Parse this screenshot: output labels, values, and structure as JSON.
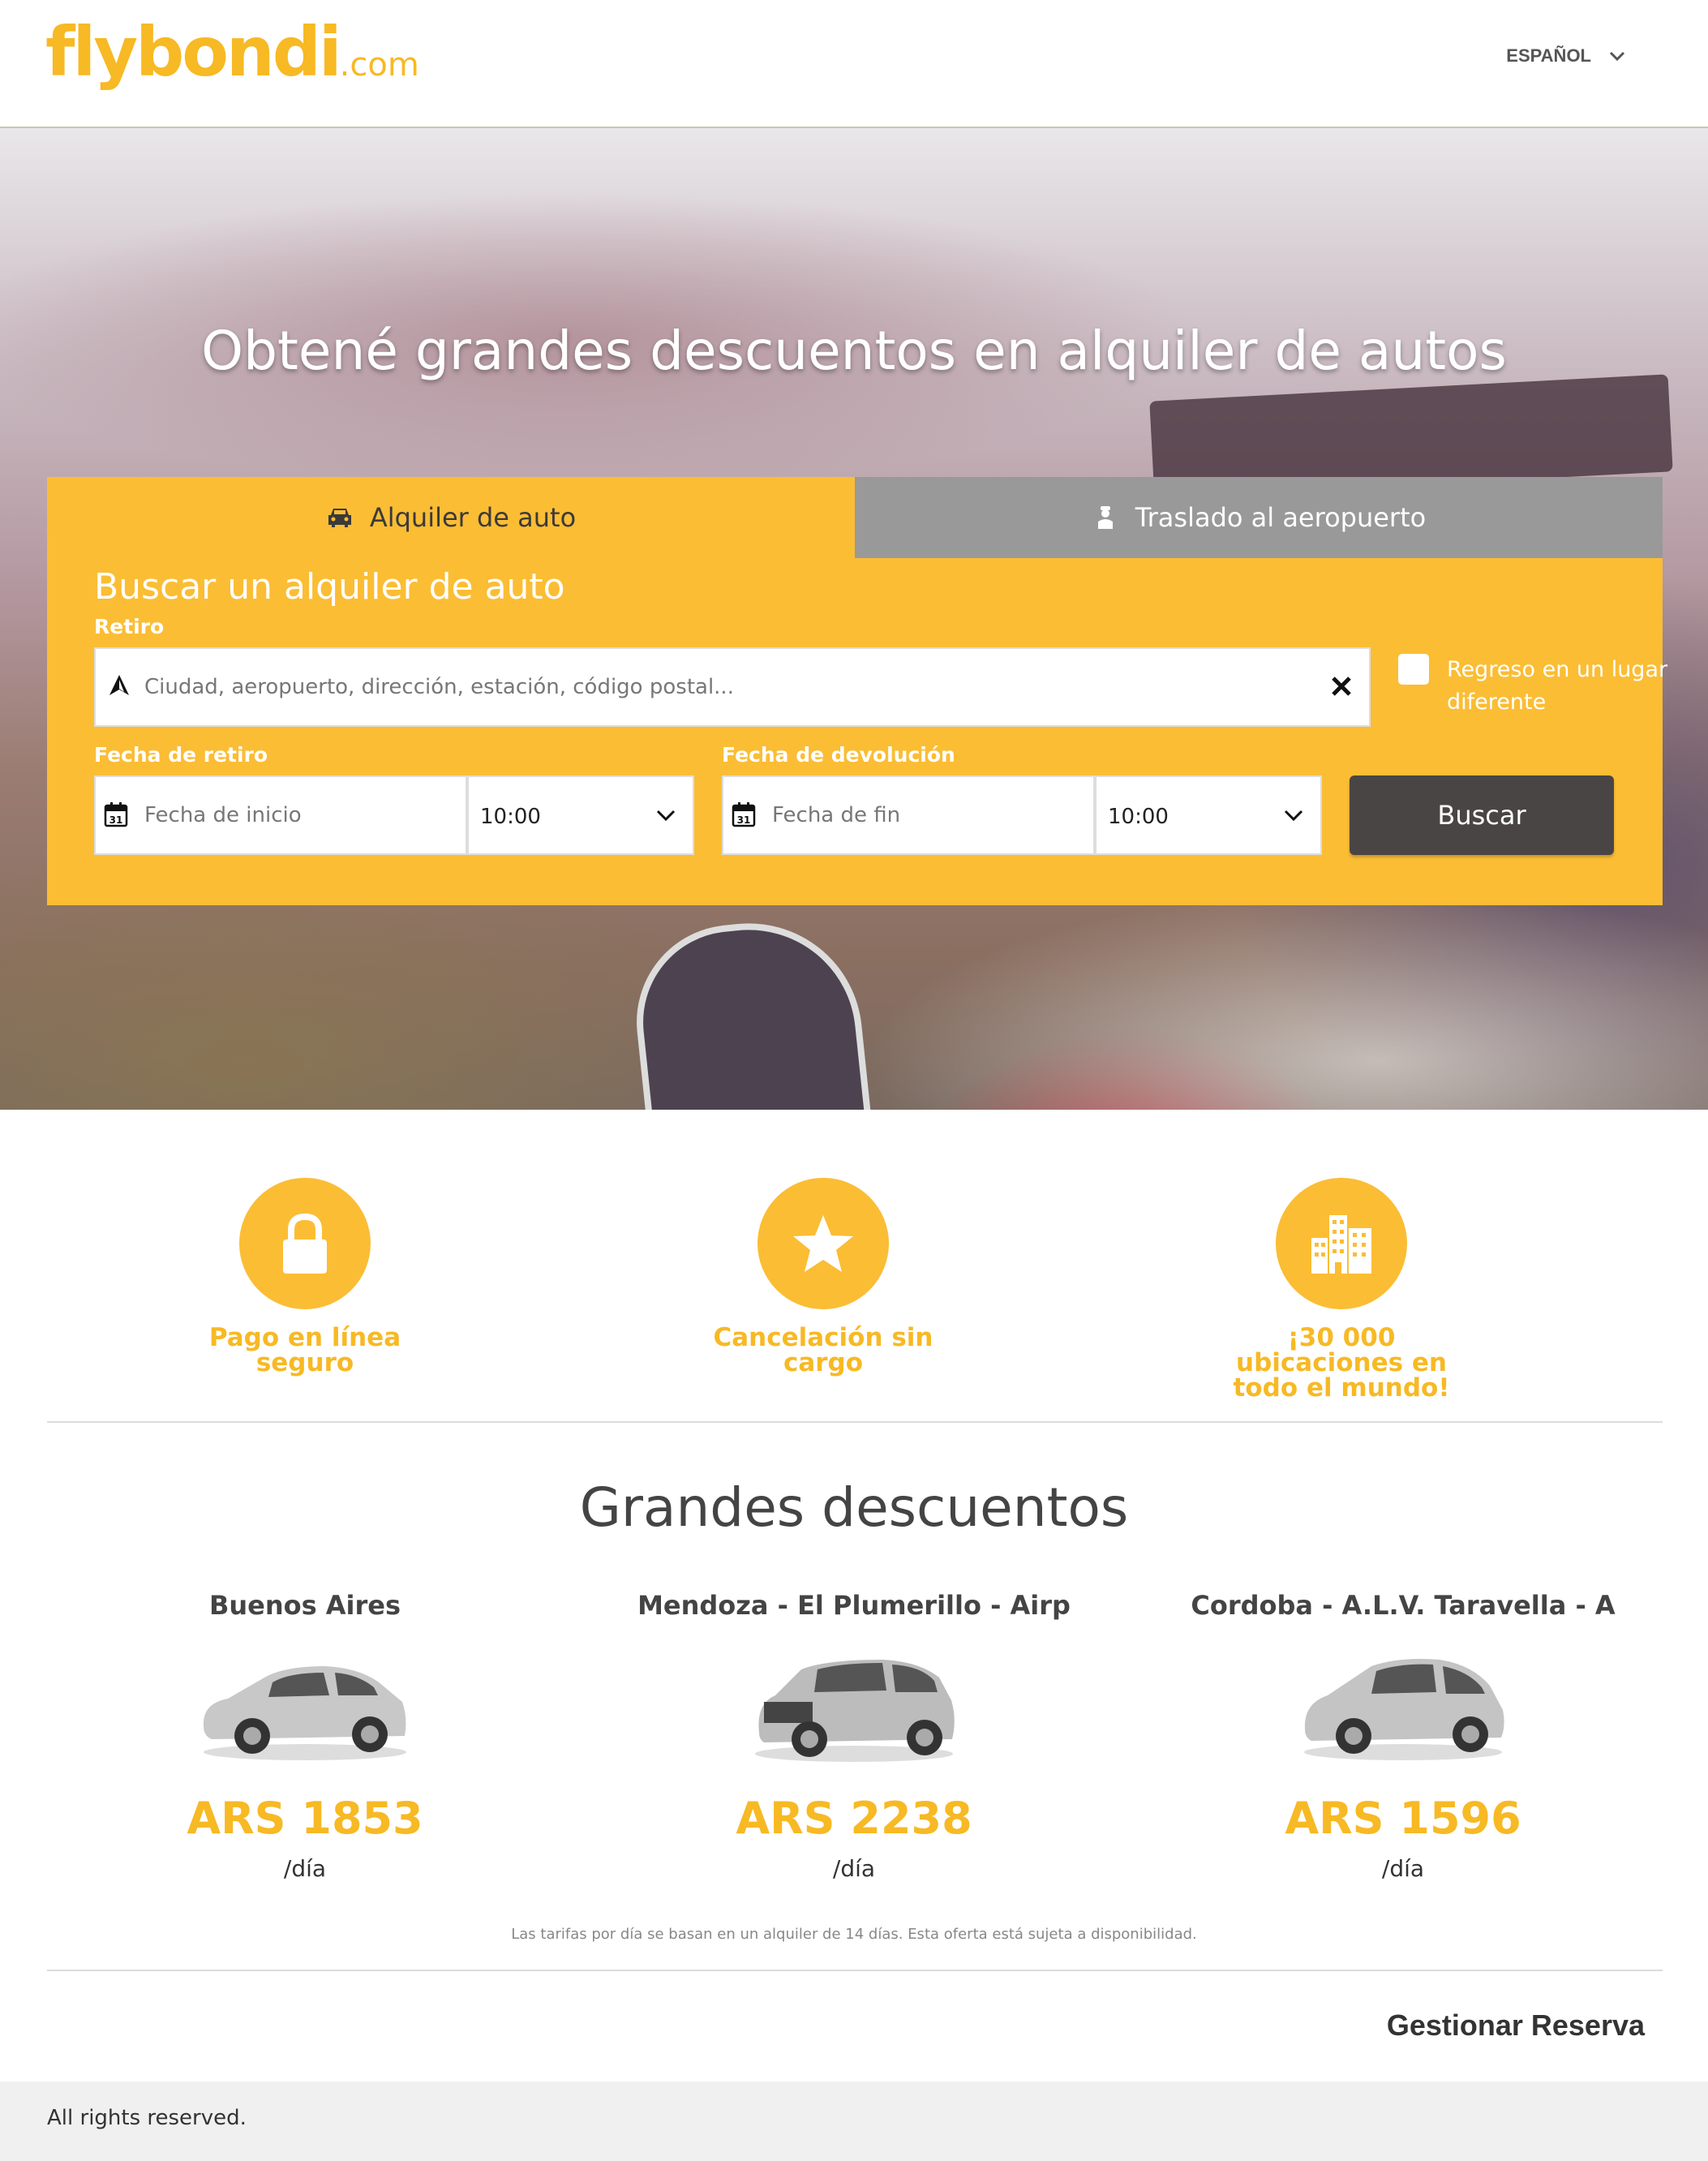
{
  "header": {
    "logo_main": "flybondi",
    "logo_suffix": ".com",
    "language": "ESPAÑOL"
  },
  "hero": {
    "title": "Obtené grandes descuentos en alquiler de autos"
  },
  "tabs": [
    {
      "label": "Alquiler de auto",
      "icon": "car-icon",
      "active": true
    },
    {
      "label": "Traslado al aeropuerto",
      "icon": "chauffeur-icon",
      "active": false
    }
  ],
  "search": {
    "title": "Buscar un alquiler de auto",
    "pickup_label": "Retiro",
    "pickup_placeholder": "Ciudad, aeropuerto, dirección, estación, código postal...",
    "different_return_label": "Regreso en un lugar diferente",
    "pickup_date_label": "Fecha de retiro",
    "pickup_date_placeholder": "Fecha de inicio",
    "pickup_time": "10:00",
    "return_date_label": "Fecha de devolución",
    "return_date_placeholder": "Fecha de fin",
    "return_time": "10:00",
    "submit_label": "Buscar"
  },
  "features": [
    {
      "text": "Pago en línea seguro",
      "icon": "lock-icon"
    },
    {
      "text": "Cancelación sin cargo",
      "icon": "star-icon"
    },
    {
      "text": "¡30 000 ubicaciones en todo el mundo!",
      "icon": "buildings-icon"
    }
  ],
  "deals": {
    "title": "Grandes descuentos",
    "items": [
      {
        "city": "Buenos Aires",
        "price": "ARS 1853",
        "per": "/día"
      },
      {
        "city": "Mendoza - El Plumerillo - Airp",
        "price": "ARS 2238",
        "per": "/día"
      },
      {
        "city": "Cordoba - A.L.V. Taravella - A",
        "price": "ARS 1596",
        "per": "/día"
      }
    ],
    "disclaimer": "Las tarifas por día se basan en un alquiler de 14 días. Esta oferta está sujeta a disponibilidad."
  },
  "manage_booking": "Gestionar Reserva",
  "footer": {
    "text": "All rights reserved."
  },
  "colors": {
    "brand_yellow": "#fbbd34",
    "tab_inactive": "#999999",
    "button_dark": "#4a4545"
  }
}
